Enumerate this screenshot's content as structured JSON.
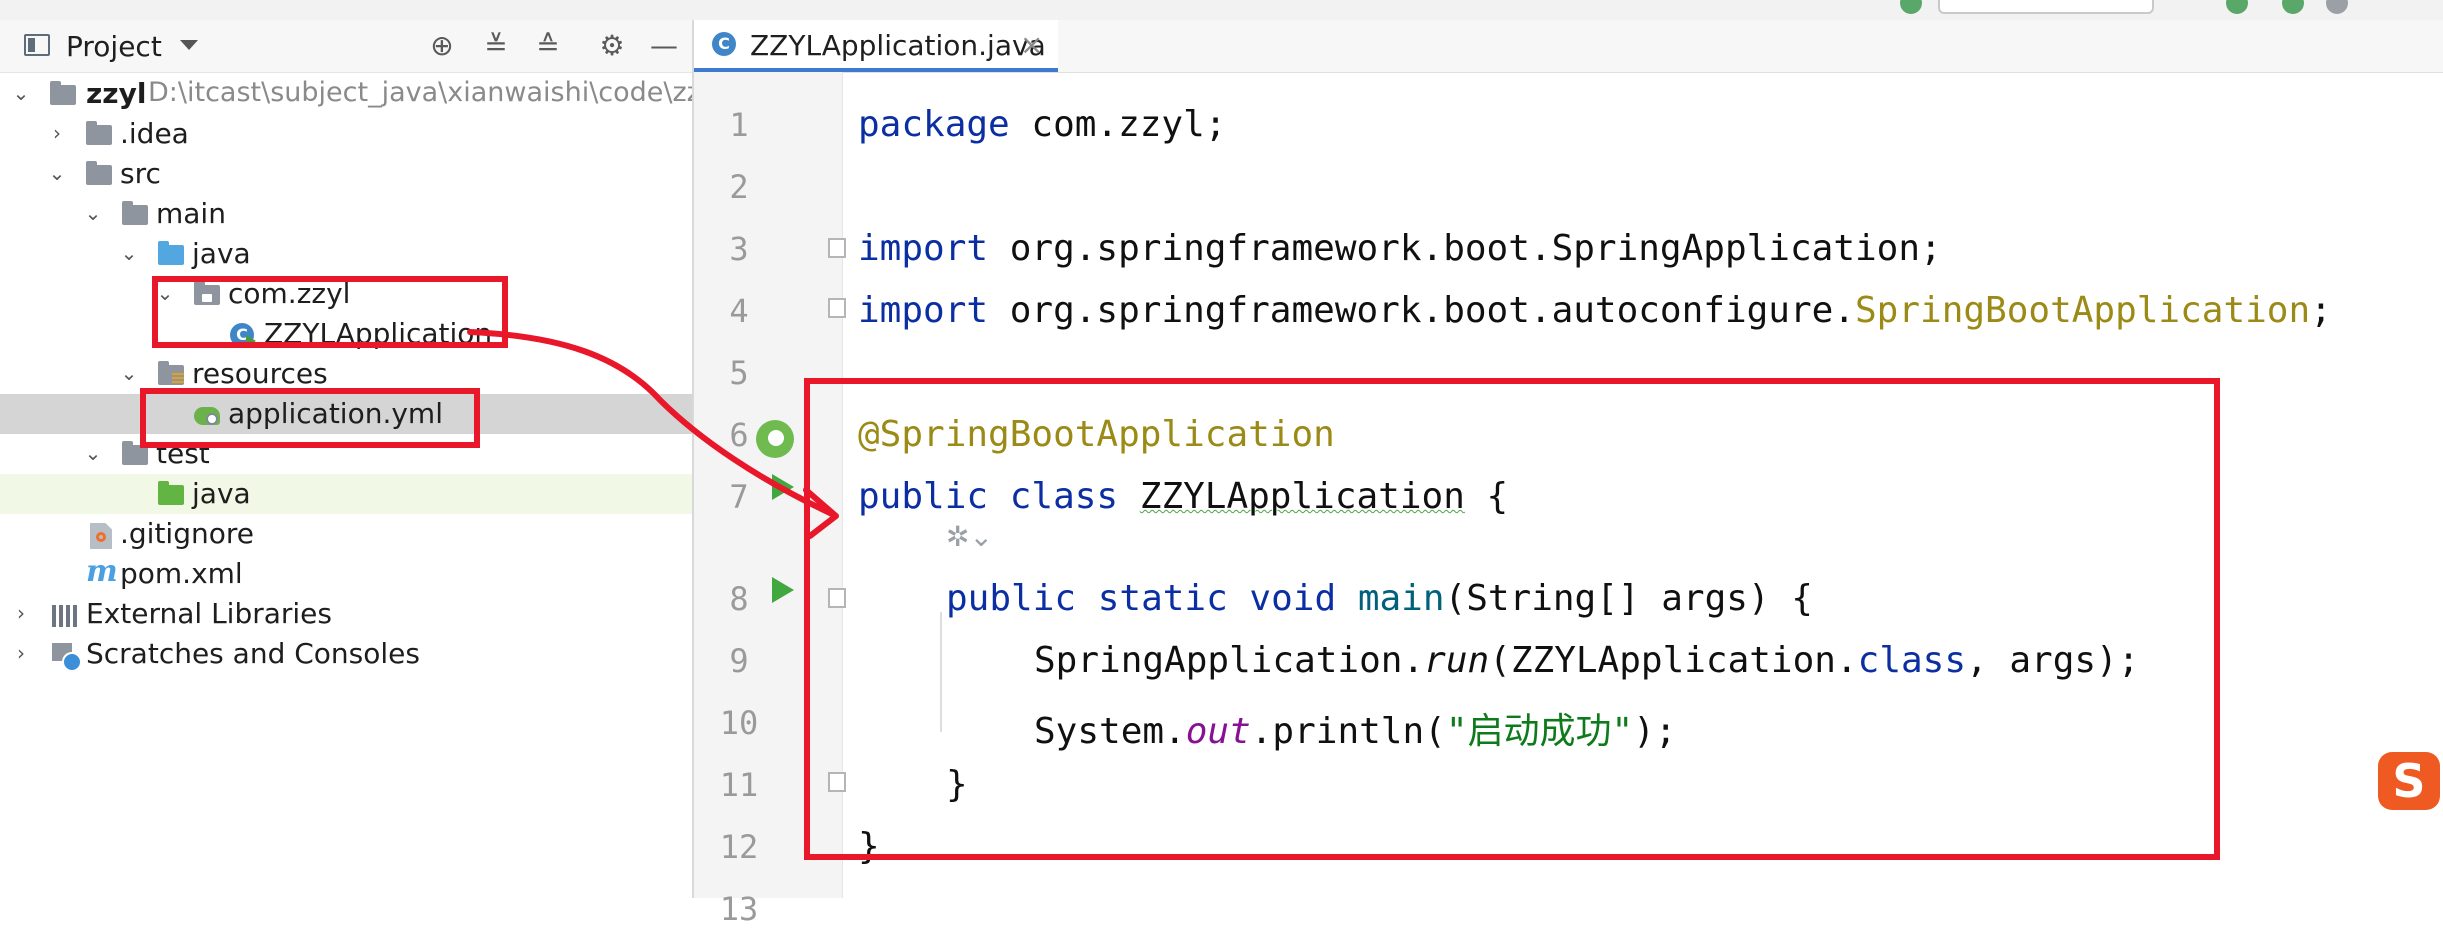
{
  "project_panel": {
    "title": "Project",
    "tree": [
      {
        "key": "root",
        "label": "zzyl",
        "path": "D:\\itcast\\subject_java\\xianwaishi\\code\\zzyl"
      },
      {
        "key": "idea",
        "label": ".idea"
      },
      {
        "key": "src",
        "label": "src"
      },
      {
        "key": "main",
        "label": "main"
      },
      {
        "key": "java",
        "label": "java"
      },
      {
        "key": "pkg",
        "label": "com.zzyl"
      },
      {
        "key": "app",
        "label": "ZZYLApplication"
      },
      {
        "key": "resources",
        "label": "resources"
      },
      {
        "key": "yml",
        "label": "application.yml"
      },
      {
        "key": "test",
        "label": "test"
      },
      {
        "key": "testjava",
        "label": "java"
      },
      {
        "key": "gitignore",
        "label": ".gitignore"
      },
      {
        "key": "pom",
        "label": "pom.xml"
      },
      {
        "key": "libs",
        "label": "External Libraries"
      },
      {
        "key": "scratches",
        "label": "Scratches and Consoles"
      }
    ]
  },
  "editor": {
    "tab_label": "ZZYLApplication.java",
    "line_numbers": [
      "1",
      "2",
      "3",
      "4",
      "5",
      "6",
      "7",
      "8",
      "9",
      "10",
      "11",
      "12",
      "13"
    ],
    "code": {
      "l1_kw": "package",
      "l1_rest": " com.zzyl;",
      "l3_kw": "import",
      "l3_rest": " org.springframework.boot.SpringApplication;",
      "l4_kw": "import",
      "l4_rest": " org.springframework.boot.autoconfigure.",
      "l4_ann": "SpringBootApplication",
      "l4_end": ";",
      "l6_ann": "@SpringBootApplication",
      "l7_kw": "public class ",
      "l7_name": "ZZYLApplication",
      "l7_end": " {",
      "l8_kw": "public static void ",
      "l8_fn": "main",
      "l8_rest": "(String[] args) {",
      "l9_a": "SpringApplication.",
      "l9_run": "run",
      "l9_b": "(ZZYLApplication.",
      "l9_kw": "class",
      "l9_c": ", args);",
      "l10_a": "System.",
      "l10_out": "out",
      "l10_b": ".println(",
      "l10_str": "\"启动成功\"",
      "l10_c": ");",
      "l11": "}",
      "l12": "}"
    }
  },
  "overlay": {
    "sogou_label": "S",
    "annotation_color": "#e8182a"
  }
}
